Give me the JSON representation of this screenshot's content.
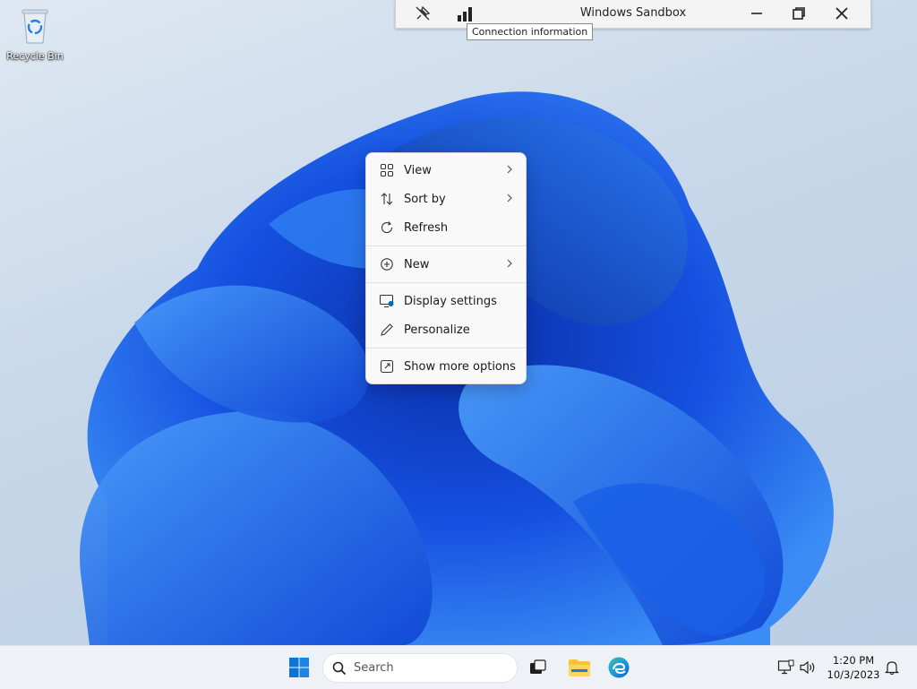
{
  "desktop": {
    "recycle_bin_label": "Recycle Bin"
  },
  "rdp_bar": {
    "title": "Windows Sandbox",
    "tooltip": "Connection information",
    "icons": [
      "pin-icon",
      "connection-bars-icon",
      "minimize-icon",
      "restore-icon",
      "close-icon"
    ]
  },
  "context_menu": {
    "items": [
      {
        "label": "View",
        "icon": "grid-icon",
        "submenu": true
      },
      {
        "label": "Sort by",
        "icon": "sort-icon",
        "submenu": true
      },
      {
        "label": "Refresh",
        "icon": "refresh-icon",
        "submenu": false
      },
      {
        "label": "New",
        "icon": "plus-circle-icon",
        "submenu": true
      },
      {
        "label": "Display settings",
        "icon": "display-icon",
        "submenu": false
      },
      {
        "label": "Personalize",
        "icon": "pen-icon",
        "submenu": false
      },
      {
        "label": "Show more options",
        "icon": "expand-icon",
        "submenu": false
      }
    ]
  },
  "taskbar": {
    "search_placeholder": "Search",
    "clock_time": "1:20 PM",
    "clock_date": "10/3/2023"
  },
  "colors": {
    "accent": "#0067c0",
    "bloom_dark": "#0a3fbf",
    "bloom_light": "#3b8cf5"
  }
}
